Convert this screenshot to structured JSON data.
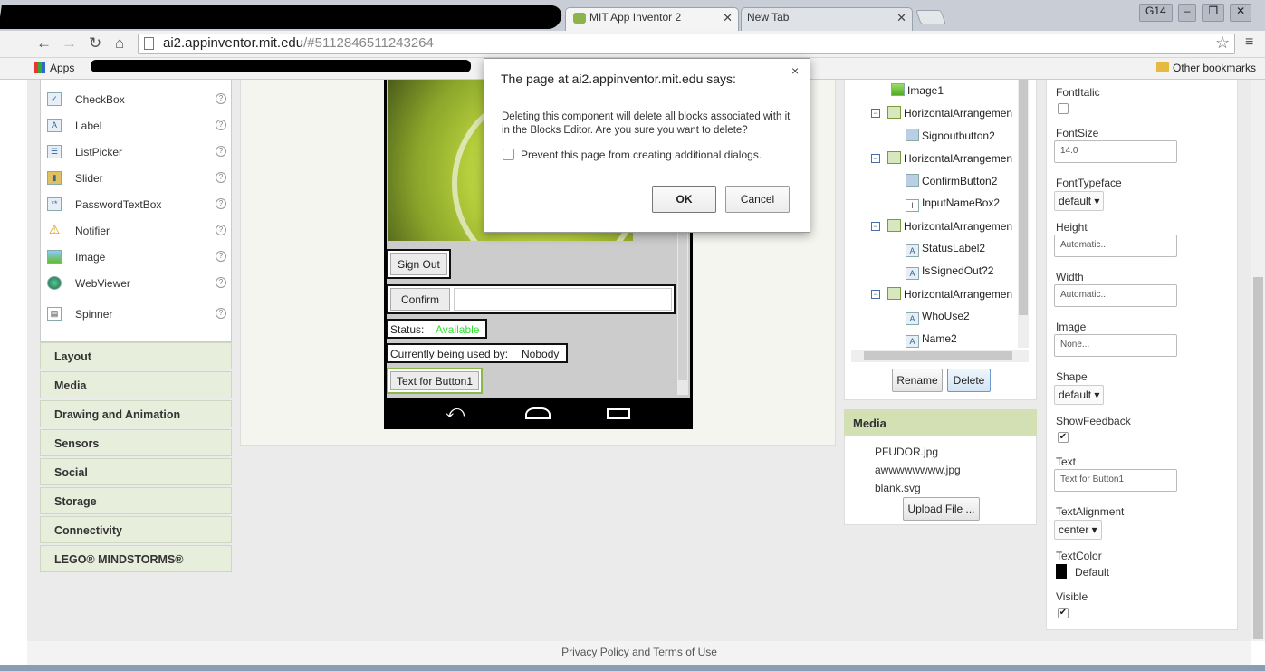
{
  "browser": {
    "tabs": [
      {
        "label": "MIT App Inventor 2",
        "close": "✕"
      },
      {
        "label": "New Tab",
        "close": "✕"
      }
    ],
    "profile": "G14",
    "url_host": "ai2.appinventor.mit.edu",
    "url_path": "/#5112846511243264",
    "bookmarks": {
      "apps": "Apps",
      "other": "Other bookmarks"
    }
  },
  "palette": {
    "items": [
      {
        "label": "CheckBox",
        "icon": "checkbox-icon"
      },
      {
        "label": "Label",
        "icon": "label-icon"
      },
      {
        "label": "ListPicker",
        "icon": "listpicker-icon"
      },
      {
        "label": "Slider",
        "icon": "slider-icon"
      },
      {
        "label": "PasswordTextBox",
        "icon": "password-icon"
      },
      {
        "label": "Notifier",
        "icon": "notifier-icon"
      },
      {
        "label": "Image",
        "icon": "image-icon"
      },
      {
        "label": "WebViewer",
        "icon": "globe-icon"
      },
      {
        "label": "Spinner",
        "icon": "spinner-icon"
      }
    ],
    "categories": [
      "Layout",
      "Media",
      "Drawing and Animation",
      "Sensors",
      "Social",
      "Storage",
      "Connectivity",
      "LEGO® MINDSTORMS®"
    ]
  },
  "viewer": {
    "sign_out": "Sign Out",
    "confirm": "Confirm",
    "status_label": "Status:",
    "status_value": "Available",
    "used_by_label": "Currently being used by:",
    "used_by_value": "Nobody",
    "button1": "Text for Button1"
  },
  "components": {
    "nodes": [
      {
        "label": "Image1"
      },
      {
        "label": "HorizontalArrangemen"
      },
      {
        "label": "Signoutbutton2"
      },
      {
        "label": "HorizontalArrangemen"
      },
      {
        "label": "ConfirmButton2"
      },
      {
        "label": "InputNameBox2"
      },
      {
        "label": "HorizontalArrangemen"
      },
      {
        "label": "StatusLabel2"
      },
      {
        "label": "IsSignedOut?2"
      },
      {
        "label": "HorizontalArrangemen"
      },
      {
        "label": "WhoUse2"
      },
      {
        "label": "Name2"
      }
    ],
    "rename": "Rename",
    "delete": "Delete"
  },
  "media": {
    "title": "Media",
    "files": [
      "PFUDOR.jpg",
      "awwwwwwww.jpg",
      "blank.svg"
    ],
    "upload": "Upload File ..."
  },
  "properties": {
    "font_italic": "FontItalic",
    "font_size": "FontSize",
    "font_size_value": "14.0",
    "font_typeface": "FontTypeface",
    "font_typeface_value": "default ▾",
    "height": "Height",
    "height_value": "Automatic...",
    "width": "Width",
    "width_value": "Automatic...",
    "image": "Image",
    "image_value": "None...",
    "shape": "Shape",
    "shape_value": "default ▾",
    "show_feedback": "ShowFeedback",
    "text": "Text",
    "text_value": "Text for Button1",
    "text_alignment": "TextAlignment",
    "text_alignment_value": "center ▾",
    "text_color": "TextColor",
    "text_color_value": "Default",
    "visible": "Visible"
  },
  "footer": {
    "link": "Privacy Policy and Terms of Use"
  },
  "dialog": {
    "title": "The page at ai2.appinventor.mit.edu says:",
    "message": "Deleting this component will delete all blocks associated with it in the Blocks Editor. Are you sure you want to delete?",
    "checkbox_label": "Prevent this page from creating additional dialogs.",
    "ok": "OK",
    "cancel": "Cancel",
    "close": "×"
  },
  "colors": {
    "status_available": "#33dd33",
    "accent_green": "#8ab84a"
  }
}
